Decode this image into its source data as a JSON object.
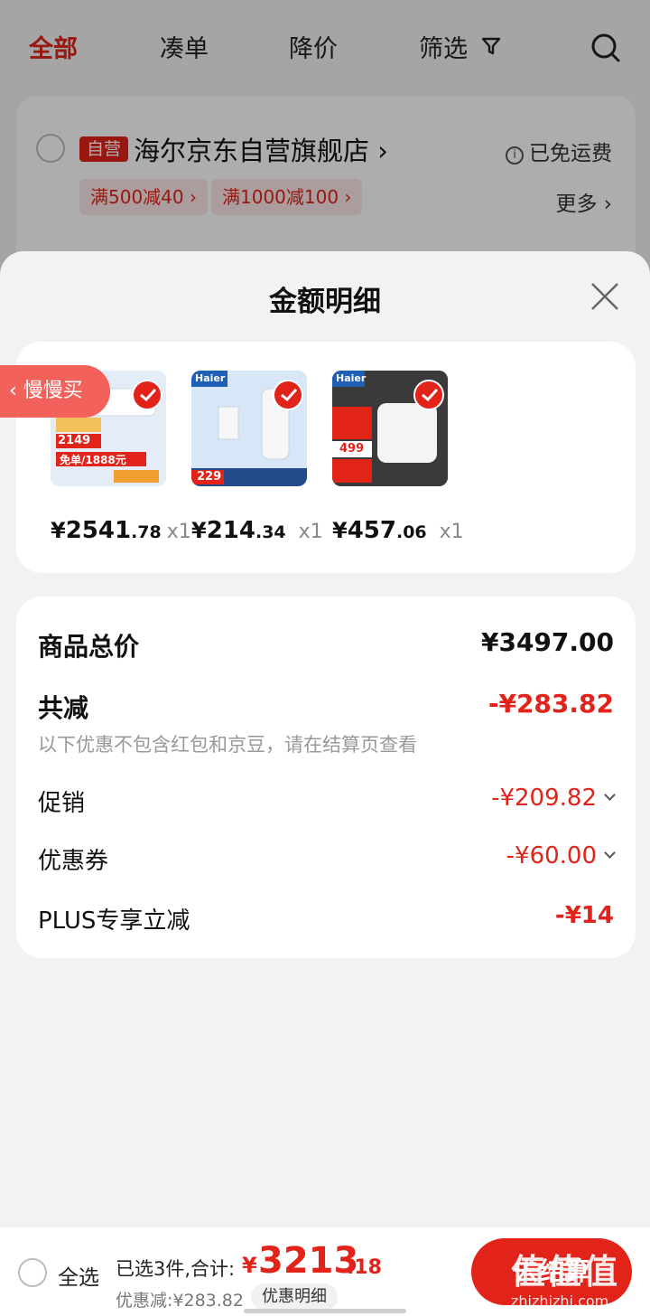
{
  "background": {
    "tabs": [
      "全部",
      "凑单",
      "降价",
      "筛选"
    ],
    "store": {
      "badge": "自营",
      "name": "海尔京东自营旗舰店",
      "arrow": "›",
      "shipping": "已免运费",
      "coupons": [
        "满500减40 ›",
        "满1000减100 ›"
      ],
      "more": "更多 ›"
    }
  },
  "sheet": {
    "title": "金额明细",
    "slow_buy": "‹ 慢慢买",
    "products": [
      {
        "yen": "¥",
        "int": "2541",
        "dec": ".78",
        "qty": "x1",
        "thumb_text": "2149",
        "thumb_text2": "免单/1888元",
        "thumb_bg": "#dfe9f7"
      },
      {
        "yen": "¥",
        "int": "214",
        "dec": ".34",
        "qty": "x1",
        "thumb_text": "229",
        "thumb_text2": "Haier",
        "thumb_bg": "#d7e7f7"
      },
      {
        "yen": "¥",
        "int": "457",
        "dec": ".06",
        "qty": "x1",
        "thumb_text": "499",
        "thumb_text2": "Haier",
        "thumb_bg": "#3a3a3a"
      }
    ],
    "summary": {
      "total_label": "商品总价",
      "total_value": "¥3497.00",
      "discount_label": "共减",
      "discount_value": "-¥283.82",
      "note": "以下优惠不包含红包和京豆，请在结算页查看",
      "promo_label": "促销",
      "promo_value": "-¥209.82",
      "coupon_label": "优惠券",
      "coupon_value": "-¥60.00",
      "plus_label": "PLUS专享立减",
      "plus_value": "-¥14"
    }
  },
  "bottom_bar": {
    "select_all": "全选",
    "selected": "已选3件,合计:",
    "total_yen": "¥",
    "total_int": "3213",
    "total_dec": ".18",
    "discount": "优惠减:¥283.82",
    "detail_btn": "优惠明细",
    "checkout": "去结算"
  },
  "watermark": {
    "main": "值值值",
    "sub": "zhizhizhi.com"
  },
  "colors": {
    "accent": "#e2231a",
    "sheet_bg": "#f2f2f2",
    "card_bg": "#ffffff"
  }
}
